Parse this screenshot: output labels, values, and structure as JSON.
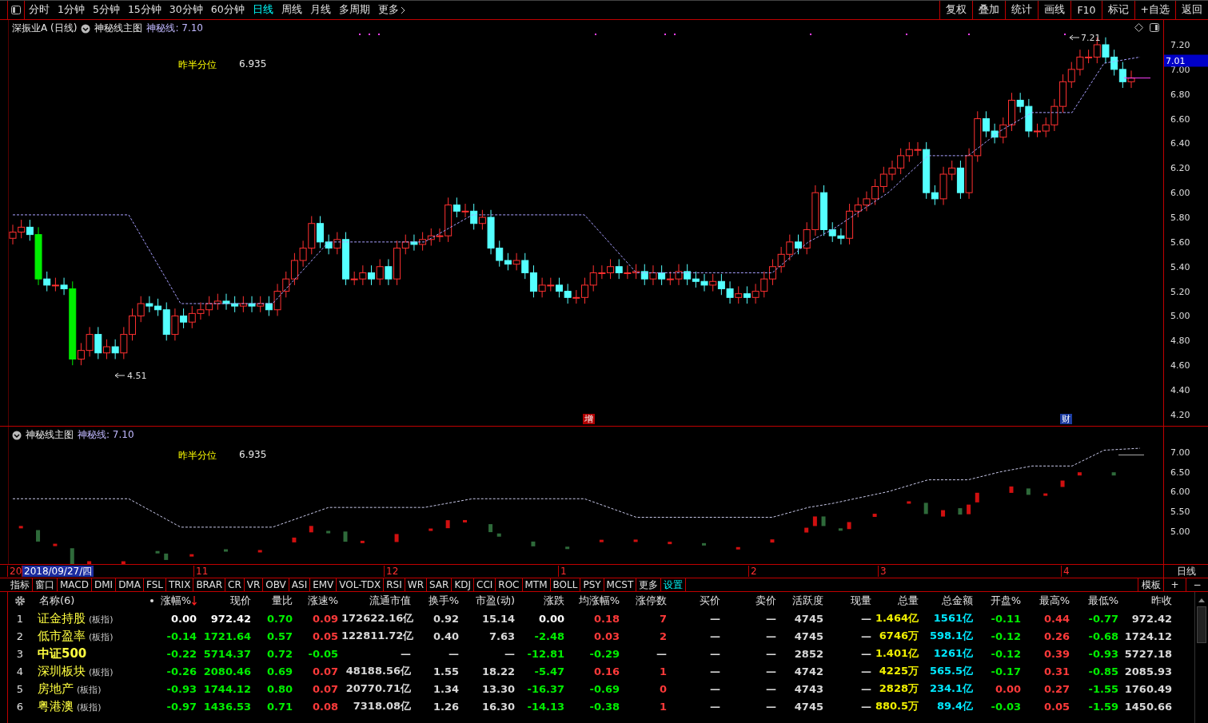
{
  "toolbar": {
    "periods": [
      {
        "label": "分时",
        "selected": false
      },
      {
        "label": "1分钟",
        "selected": false
      },
      {
        "label": "5分钟",
        "selected": false
      },
      {
        "label": "15分钟",
        "selected": false
      },
      {
        "label": "30分钟",
        "selected": false
      },
      {
        "label": "60分钟",
        "selected": false
      },
      {
        "label": "日线",
        "selected": true
      },
      {
        "label": "周线",
        "selected": false
      },
      {
        "label": "月线",
        "selected": false
      },
      {
        "label": "多周期",
        "selected": false
      },
      {
        "label": "更多",
        "selected": false
      }
    ],
    "actions": [
      "复权",
      "叠加",
      "统计",
      "画线",
      "F10",
      "标记",
      "+自选",
      "返回"
    ]
  },
  "main_chart": {
    "stock": "深振业A (日线)",
    "indicator": "神秘线主图",
    "line_value": "神秘线: 7.10",
    "level_label": "昨半分位",
    "level_value": "6.935",
    "low_mark": "4.51",
    "high_mark": "7.21",
    "events": [
      {
        "text": "增",
        "kind": "increase"
      },
      {
        "text": "财",
        "kind": "finance"
      }
    ],
    "price_ticks": [
      "7.20",
      "7.00",
      "6.80",
      "6.60",
      "6.40",
      "6.20",
      "6.00",
      "5.80",
      "5.60",
      "5.40",
      "5.20",
      "5.00",
      "4.80",
      "4.60",
      "4.40",
      "4.20"
    ],
    "current_price": "7.01"
  },
  "sub_chart": {
    "indicator": "神秘线主图",
    "line_value": "神秘线: 7.10",
    "level_label": "昨半分位",
    "level_value": "6.935",
    "price_ticks": [
      "7.00",
      "6.50",
      "6.00",
      "5.50",
      "5.00"
    ]
  },
  "date_axis": {
    "labels": [
      {
        "text": "20",
        "selected": false
      },
      {
        "text": "2018/09/27/四",
        "selected": true
      },
      {
        "text": "11",
        "selected": false
      },
      {
        "text": "12",
        "selected": false
      },
      {
        "text": "1",
        "selected": false
      },
      {
        "text": "2",
        "selected": false
      },
      {
        "text": "3",
        "selected": false
      },
      {
        "text": "4",
        "selected": false
      }
    ],
    "period": "日线"
  },
  "indicator_tabs": [
    {
      "label": "指标",
      "selected": false
    },
    {
      "label": "窗口",
      "selected": false
    },
    {
      "label": "MACD",
      "selected": false
    },
    {
      "label": "DMI",
      "selected": false
    },
    {
      "label": "DMA",
      "selected": false
    },
    {
      "label": "FSL",
      "selected": false
    },
    {
      "label": "TRIX",
      "selected": false
    },
    {
      "label": "BRAR",
      "selected": false
    },
    {
      "label": "CR",
      "selected": false
    },
    {
      "label": "VR",
      "selected": false
    },
    {
      "label": "OBV",
      "selected": false
    },
    {
      "label": "ASI",
      "selected": false
    },
    {
      "label": "EMV",
      "selected": false
    },
    {
      "label": "VOL-TDX",
      "selected": false
    },
    {
      "label": "RSI",
      "selected": false
    },
    {
      "label": "WR",
      "selected": false
    },
    {
      "label": "SAR",
      "selected": false
    },
    {
      "label": "KDJ",
      "selected": false
    },
    {
      "label": "CCI",
      "selected": false
    },
    {
      "label": "ROC",
      "selected": false
    },
    {
      "label": "MTM",
      "selected": false
    },
    {
      "label": "BOLL",
      "selected": false
    },
    {
      "label": "PSY",
      "selected": false
    },
    {
      "label": "MCST",
      "selected": false
    },
    {
      "label": "更多",
      "selected": false
    },
    {
      "label": "设置",
      "selected": true
    }
  ],
  "indicator_actions": [
    "模板",
    "+",
    "−"
  ],
  "table": {
    "name_header": "名称(6)",
    "columns": [
      {
        "label": "涨幅%",
        "sorted": true
      },
      {
        "label": "现价",
        "sorted": false
      },
      {
        "label": "量比",
        "sorted": false
      },
      {
        "label": "涨速%",
        "sorted": false
      },
      {
        "label": "流通市值",
        "sorted": false
      },
      {
        "label": "换手%",
        "sorted": false
      },
      {
        "label": "市盈(动)",
        "sorted": false
      },
      {
        "label": "涨跌",
        "sorted": false
      },
      {
        "label": "均涨幅%",
        "sorted": false
      },
      {
        "label": "涨停数",
        "sorted": false
      },
      {
        "label": "买价",
        "sorted": false
      },
      {
        "label": "卖价",
        "sorted": false
      },
      {
        "label": "活跃度",
        "sorted": false
      },
      {
        "label": "现量",
        "sorted": false
      },
      {
        "label": "总量",
        "sorted": false
      },
      {
        "label": "总金额",
        "sorted": false
      },
      {
        "label": "开盘%",
        "sorted": false
      },
      {
        "label": "最高%",
        "sorted": false
      },
      {
        "label": "最低%",
        "sorted": false
      },
      {
        "label": "昨收",
        "sorted": false
      }
    ],
    "rows": [
      {
        "index": "1",
        "name": "证金持股",
        "tag": "(板指)",
        "cells": [
          {
            "text": "0.00",
            "color": "#ffffff"
          },
          {
            "text": "972.42",
            "color": "#ffffff"
          },
          {
            "text": "0.70",
            "color": "#00ee00"
          },
          {
            "text": "0.09",
            "color": "#ff3a3a"
          },
          {
            "text": "172622.16亿",
            "color": "#d8d8d8"
          },
          {
            "text": "0.92",
            "color": "#d8d8d8"
          },
          {
            "text": "15.14",
            "color": "#d8d8d8"
          },
          {
            "text": "0.00",
            "color": "#ffffff"
          },
          {
            "text": "0.18",
            "color": "#ff3a3a"
          },
          {
            "text": "7",
            "color": "#ff3a3a"
          },
          {
            "text": "—",
            "color": "#d8d8d8"
          },
          {
            "text": "—",
            "color": "#d8d8d8"
          },
          {
            "text": "4745",
            "color": "#d8d8d8"
          },
          {
            "text": "—",
            "color": "#d8d8d8"
          },
          {
            "text": "1.464亿",
            "color": "#f0f000"
          },
          {
            "text": "1561亿",
            "color": "#00e8ff"
          },
          {
            "text": "-0.11",
            "color": "#00ee00"
          },
          {
            "text": "0.44",
            "color": "#ff3a3a"
          },
          {
            "text": "-0.77",
            "color": "#00ee00"
          },
          {
            "text": "972.42",
            "color": "#d8d8d8"
          }
        ]
      },
      {
        "index": "2",
        "name": "低市盈率",
        "tag": "(板指)",
        "cells": [
          {
            "text": "-0.14",
            "color": "#00ee00"
          },
          {
            "text": "1721.64",
            "color": "#00ee00"
          },
          {
            "text": "0.57",
            "color": "#00ee00"
          },
          {
            "text": "0.05",
            "color": "#ff3a3a"
          },
          {
            "text": "122811.72亿",
            "color": "#d8d8d8"
          },
          {
            "text": "0.40",
            "color": "#d8d8d8"
          },
          {
            "text": "7.63",
            "color": "#d8d8d8"
          },
          {
            "text": "-2.48",
            "color": "#00ee00"
          },
          {
            "text": "0.03",
            "color": "#ff3a3a"
          },
          {
            "text": "2",
            "color": "#ff3a3a"
          },
          {
            "text": "—",
            "color": "#d8d8d8"
          },
          {
            "text": "—",
            "color": "#d8d8d8"
          },
          {
            "text": "4745",
            "color": "#d8d8d8"
          },
          {
            "text": "—",
            "color": "#d8d8d8"
          },
          {
            "text": "6746万",
            "color": "#f0f000"
          },
          {
            "text": "598.1亿",
            "color": "#00e8ff"
          },
          {
            "text": "-0.12",
            "color": "#00ee00"
          },
          {
            "text": "0.26",
            "color": "#ff3a3a"
          },
          {
            "text": "-0.68",
            "color": "#00ee00"
          },
          {
            "text": "1724.12",
            "color": "#d8d8d8"
          }
        ]
      },
      {
        "index": "3",
        "name": "中证500",
        "cells": [
          {
            "text": "-0.22",
            "color": "#00ee00"
          },
          {
            "text": "5714.37",
            "color": "#00ee00"
          },
          {
            "text": "0.72",
            "color": "#00ee00"
          },
          {
            "text": "-0.05",
            "color": "#00ee00"
          },
          {
            "text": "—",
            "color": "#d8d8d8"
          },
          {
            "text": "—",
            "color": "#d8d8d8"
          },
          {
            "text": "—",
            "color": "#d8d8d8"
          },
          {
            "text": "-12.81",
            "color": "#00ee00"
          },
          {
            "text": "-0.29",
            "color": "#00ee00"
          },
          {
            "text": "—",
            "color": "#d8d8d8"
          },
          {
            "text": "—",
            "color": "#d8d8d8"
          },
          {
            "text": "—",
            "color": "#d8d8d8"
          },
          {
            "text": "2852",
            "color": "#d8d8d8"
          },
          {
            "text": "—",
            "color": "#d8d8d8"
          },
          {
            "text": "1.401亿",
            "color": "#f0f000"
          },
          {
            "text": "1261亿",
            "color": "#00e8ff"
          },
          {
            "text": "-0.12",
            "color": "#00ee00"
          },
          {
            "text": "0.39",
            "color": "#ff3a3a"
          },
          {
            "text": "-0.93",
            "color": "#00ee00"
          },
          {
            "text": "5727.18",
            "color": "#d8d8d8"
          }
        ]
      },
      {
        "index": "4",
        "name": "深圳板块",
        "tag": "(板指)",
        "cells": [
          {
            "text": "-0.26",
            "color": "#00ee00"
          },
          {
            "text": "2080.46",
            "color": "#00ee00"
          },
          {
            "text": "0.69",
            "color": "#00ee00"
          },
          {
            "text": "0.07",
            "color": "#ff3a3a"
          },
          {
            "text": "48188.56亿",
            "color": "#d8d8d8"
          },
          {
            "text": "1.55",
            "color": "#d8d8d8"
          },
          {
            "text": "18.22",
            "color": "#d8d8d8"
          },
          {
            "text": "-5.47",
            "color": "#00ee00"
          },
          {
            "text": "0.16",
            "color": "#ff3a3a"
          },
          {
            "text": "1",
            "color": "#ff3a3a"
          },
          {
            "text": "—",
            "color": "#d8d8d8"
          },
          {
            "text": "—",
            "color": "#d8d8d8"
          },
          {
            "text": "4742",
            "color": "#d8d8d8"
          },
          {
            "text": "—",
            "color": "#d8d8d8"
          },
          {
            "text": "4225万",
            "color": "#f0f000"
          },
          {
            "text": "565.5亿",
            "color": "#00e8ff"
          },
          {
            "text": "-0.17",
            "color": "#00ee00"
          },
          {
            "text": "0.31",
            "color": "#ff3a3a"
          },
          {
            "text": "-0.85",
            "color": "#00ee00"
          },
          {
            "text": "2085.93",
            "color": "#d8d8d8"
          }
        ]
      },
      {
        "index": "5",
        "name": "房地产",
        "tag": "(板指)",
        "cells": [
          {
            "text": "-0.93",
            "color": "#00ee00"
          },
          {
            "text": "1744.12",
            "color": "#00ee00"
          },
          {
            "text": "0.80",
            "color": "#00ee00"
          },
          {
            "text": "0.07",
            "color": "#ff3a3a"
          },
          {
            "text": "20770.71亿",
            "color": "#d8d8d8"
          },
          {
            "text": "1.34",
            "color": "#d8d8d8"
          },
          {
            "text": "13.30",
            "color": "#d8d8d8"
          },
          {
            "text": "-16.37",
            "color": "#00ee00"
          },
          {
            "text": "-0.69",
            "color": "#00ee00"
          },
          {
            "text": "0",
            "color": "#ff3a3a"
          },
          {
            "text": "—",
            "color": "#d8d8d8"
          },
          {
            "text": "—",
            "color": "#d8d8d8"
          },
          {
            "text": "4743",
            "color": "#d8d8d8"
          },
          {
            "text": "—",
            "color": "#d8d8d8"
          },
          {
            "text": "2828万",
            "color": "#f0f000"
          },
          {
            "text": "234.1亿",
            "color": "#00e8ff"
          },
          {
            "text": "0.00",
            "color": "#ff3a3a"
          },
          {
            "text": "0.27",
            "color": "#ff3a3a"
          },
          {
            "text": "-1.55",
            "color": "#00ee00"
          },
          {
            "text": "1760.49",
            "color": "#d8d8d8"
          }
        ]
      },
      {
        "index": "6",
        "name": "粤港澳",
        "tag": "(板指)",
        "cells": [
          {
            "text": "-0.97",
            "color": "#00ee00"
          },
          {
            "text": "1436.53",
            "color": "#00ee00"
          },
          {
            "text": "0.71",
            "color": "#00ee00"
          },
          {
            "text": "0.08",
            "color": "#ff3a3a"
          },
          {
            "text": "7318.08亿",
            "color": "#d8d8d8"
          },
          {
            "text": "1.26",
            "color": "#d8d8d8"
          },
          {
            "text": "16.30",
            "color": "#d8d8d8"
          },
          {
            "text": "-14.13",
            "color": "#00ee00"
          },
          {
            "text": "-0.38",
            "color": "#00ee00"
          },
          {
            "text": "1",
            "color": "#ff3a3a"
          },
          {
            "text": "—",
            "color": "#d8d8d8"
          },
          {
            "text": "—",
            "color": "#d8d8d8"
          },
          {
            "text": "4745",
            "color": "#d8d8d8"
          },
          {
            "text": "—",
            "color": "#d8d8d8"
          },
          {
            "text": "880.5万",
            "color": "#f0f000"
          },
          {
            "text": "89.4亿",
            "color": "#00e8ff"
          },
          {
            "text": "-0.03",
            "color": "#00ee00"
          },
          {
            "text": "0.05",
            "color": "#ff3a3a"
          },
          {
            "text": "-1.59",
            "color": "#00ee00"
          },
          {
            "text": "1450.66",
            "color": "#d8d8d8"
          }
        ]
      }
    ]
  }
}
